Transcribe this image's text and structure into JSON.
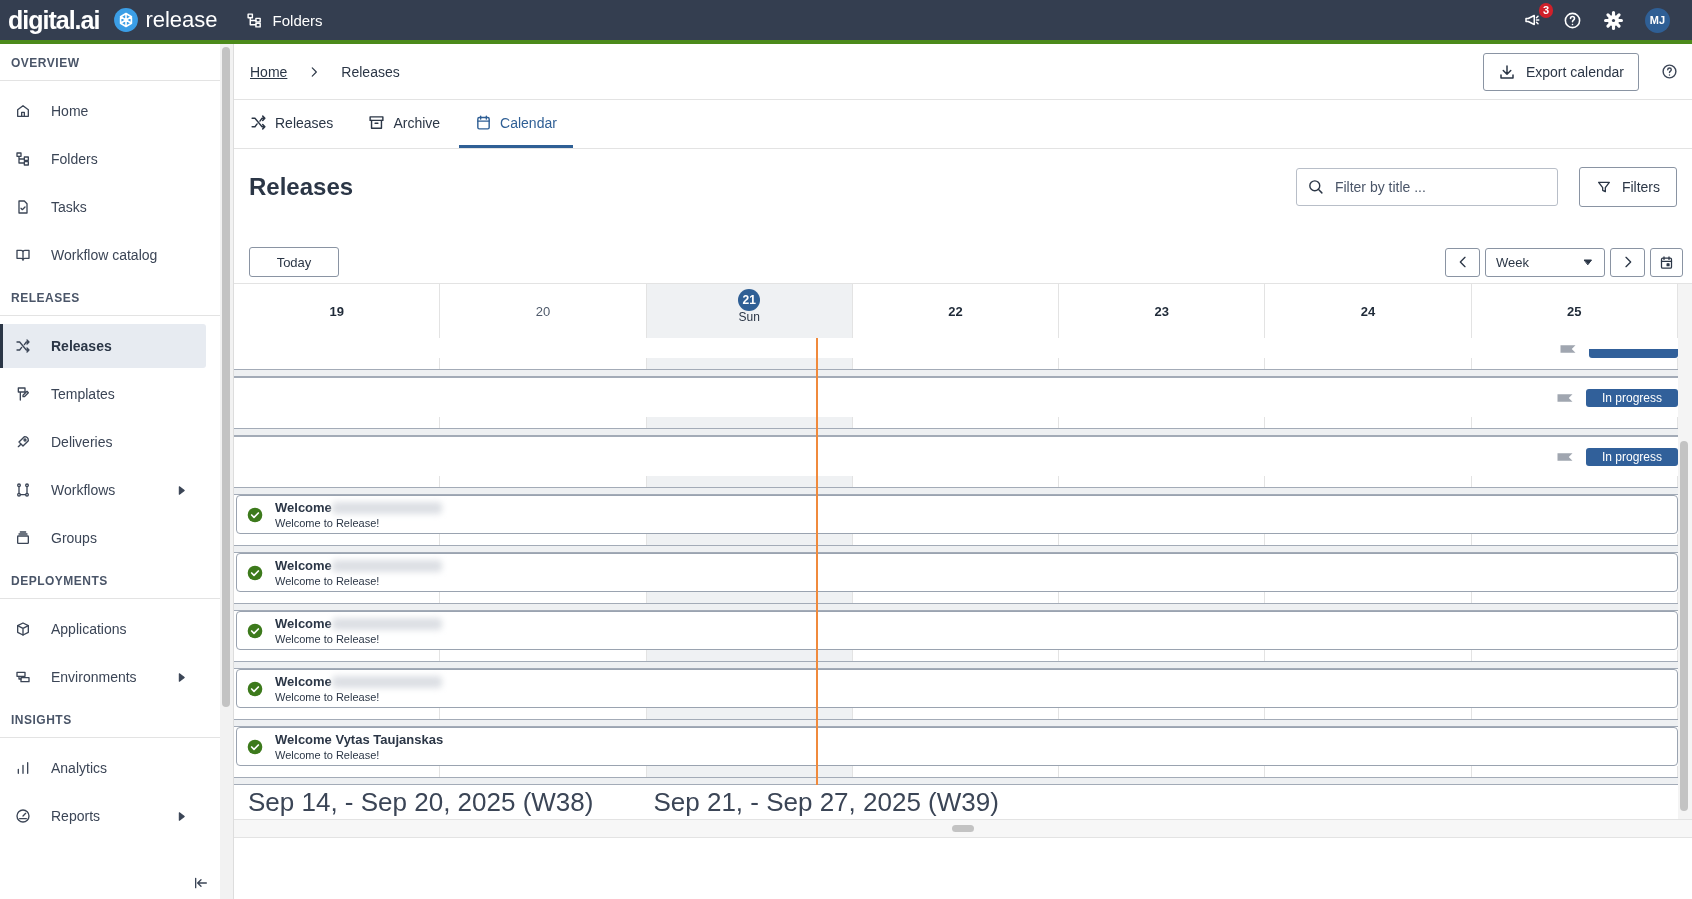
{
  "topbar": {
    "brand": "digital.ai",
    "product": "release",
    "nav_link": "Folders",
    "notification_count": "3",
    "avatar": "MJ"
  },
  "sidebar": {
    "sections": [
      {
        "title": "OVERVIEW",
        "items": [
          {
            "label": "Home",
            "kind": "link",
            "selected": false
          },
          {
            "label": "Folders",
            "kind": "link",
            "selected": false
          },
          {
            "label": "Tasks",
            "kind": "link",
            "selected": false
          },
          {
            "label": "Workflow catalog",
            "kind": "link",
            "selected": false
          }
        ]
      },
      {
        "title": "RELEASES",
        "items": [
          {
            "label": "Releases",
            "kind": "link",
            "selected": true
          },
          {
            "label": "Templates",
            "kind": "link",
            "selected": false
          },
          {
            "label": "Deliveries",
            "kind": "link",
            "selected": false
          },
          {
            "label": "Workflows",
            "kind": "group",
            "expanded": false,
            "selected": false
          },
          {
            "label": "Groups",
            "kind": "link",
            "selected": false
          }
        ]
      },
      {
        "title": "DEPLOYMENTS",
        "items": [
          {
            "label": "Applications",
            "kind": "link",
            "selected": false
          },
          {
            "label": "Environments",
            "kind": "group",
            "expanded": false,
            "selected": false
          }
        ]
      },
      {
        "title": "INSIGHTS",
        "items": [
          {
            "label": "Analytics",
            "kind": "link",
            "selected": false
          },
          {
            "label": "Reports",
            "kind": "group",
            "expanded": false,
            "selected": false
          }
        ]
      }
    ]
  },
  "breadcrumbs": [
    "Home",
    "Releases"
  ],
  "export_button": "Export calendar",
  "tabs": [
    {
      "label": "Releases",
      "selected": false
    },
    {
      "label": "Archive",
      "selected": false
    },
    {
      "label": "Calendar",
      "selected": true
    }
  ],
  "heading": "Releases",
  "search": {
    "placeholder": "Filter by title ..."
  },
  "filters_button": "Filters",
  "today_button": "Today",
  "view_select": "Week",
  "days": [
    {
      "label": "19",
      "bold": true,
      "today": false
    },
    {
      "label": "20",
      "bold": false,
      "today": false
    },
    {
      "label": "21",
      "weekday": "Sun",
      "today": true
    },
    {
      "label": "22",
      "bold": true,
      "today": false
    },
    {
      "label": "23",
      "bold": true,
      "today": false
    },
    {
      "label": "24",
      "bold": true,
      "today": false
    },
    {
      "label": "25",
      "bold": true,
      "today": false
    }
  ],
  "rows": [
    {
      "kind": "cut"
    },
    {
      "kind": "status",
      "status": "In progress"
    },
    {
      "kind": "status",
      "status": "In progress"
    },
    {
      "kind": "release",
      "title": "Welcome",
      "subtitle": "Welcome to Release!",
      "completed": true,
      "blurred": true
    },
    {
      "kind": "release",
      "title": "Welcome",
      "subtitle": "Welcome to Release!",
      "completed": true,
      "blurred": true
    },
    {
      "kind": "release",
      "title": "Welcome",
      "subtitle": "Welcome to Release!",
      "completed": true,
      "blurred": true
    },
    {
      "kind": "release",
      "title": "Welcome",
      "subtitle": "Welcome to Release!",
      "completed": true,
      "blurred": true
    },
    {
      "kind": "release",
      "title": "Welcome Vytas Taujanskas",
      "subtitle": "Welcome to Release!",
      "completed": true,
      "blurred": false
    }
  ],
  "week_labels": [
    "Sep 14, - Sep 20, 2025 (W38)",
    "Sep 21, - Sep 27, 2025 (W39)"
  ]
}
